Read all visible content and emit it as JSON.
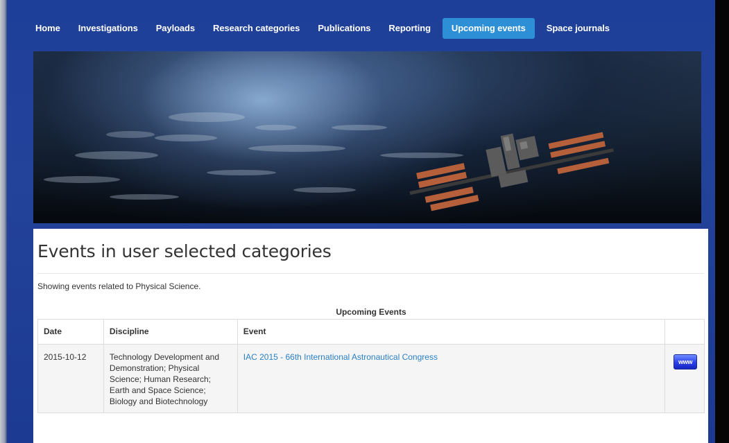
{
  "nav": {
    "items": [
      {
        "label": "Home"
      },
      {
        "label": "Investigations"
      },
      {
        "label": "Payloads"
      },
      {
        "label": "Research categories"
      },
      {
        "label": "Publications"
      },
      {
        "label": "Reporting"
      },
      {
        "label": "Upcoming events"
      },
      {
        "label": "Space journals"
      }
    ],
    "active": "Upcoming events"
  },
  "page": {
    "title": "Events in user selected categories",
    "intro": "Showing events related to Physical Science."
  },
  "events_table": {
    "caption": "Upcoming Events",
    "columns": [
      "Date",
      "Discipline",
      "Event",
      ""
    ],
    "rows": [
      {
        "date": "2015-10-12",
        "discipline": "Technology Development and Demonstration; Physical Science; Human Research; Earth and Space Science; Biology and Biotechnology",
        "event": "IAC 2015 - 66th International Astronautical Congress",
        "link_label": "www"
      }
    ]
  },
  "colors": {
    "frame_blue": "#1f3f99",
    "active_tab": "#2d8fd5",
    "link": "#2a7fc4"
  },
  "banner": {
    "image": "earth-orbit-space-station-photo"
  }
}
